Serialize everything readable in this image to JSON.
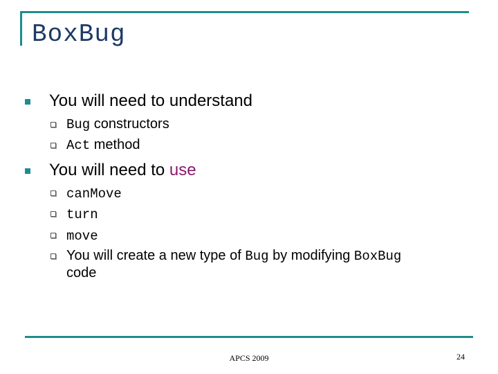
{
  "slide": {
    "title": "BoxBug",
    "sections": [
      {
        "heading": "You will need to understand",
        "items": [
          {
            "code": "Bug",
            "text": " constructors"
          },
          {
            "code": "Act",
            "text": " method"
          }
        ]
      },
      {
        "heading_prefix": "You will need to ",
        "heading_accent": "use",
        "items": [
          {
            "code": "canMove"
          },
          {
            "code": "turn"
          },
          {
            "code": "move"
          },
          {
            "text_a": "You will create a new type of ",
            "code_a": "Bug",
            "text_b": " by modifying ",
            "code_b": "BoxBug",
            "text_c": "code"
          }
        ]
      }
    ],
    "colors": {
      "accent_rule": "#1e8c8c",
      "title": "#1c3a66",
      "highlight": "#8b1a6b"
    }
  },
  "footer": {
    "center_text": "APCS 2009",
    "page_number": "24"
  }
}
